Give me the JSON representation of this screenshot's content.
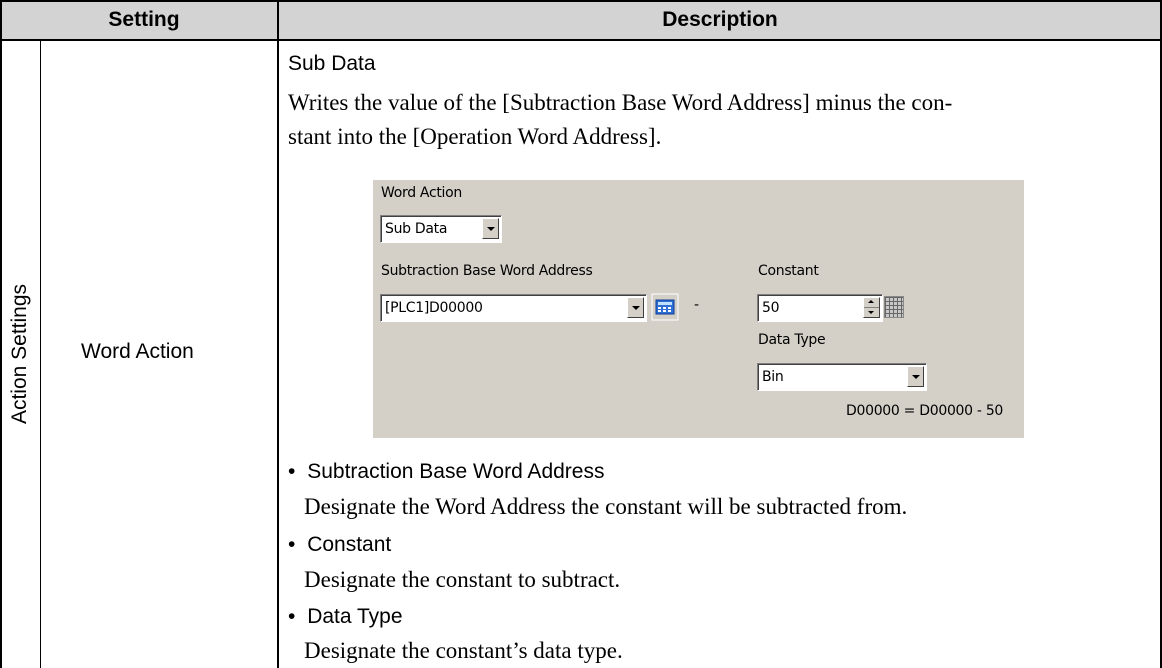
{
  "table": {
    "headers": {
      "setting": "Setting",
      "description": "Description"
    },
    "row_group": "Action Settings",
    "row_label": "Word Action"
  },
  "description": {
    "heading": "Sub Data",
    "paragraph_lines": [
      "Writes the value of the [Subtraction Base Word Address] minus the con-",
      "stant into the [Operation Word Address]."
    ],
    "bullets": [
      {
        "title": "Subtraction Base Word Address",
        "text": "Designate the Word Address the constant will be subtracted from."
      },
      {
        "title": "Constant",
        "text": "Designate the constant to subtract."
      },
      {
        "title": "Data Type",
        "text": "Designate the constant’s data type."
      }
    ],
    "bullet_char": "•"
  },
  "dialog": {
    "word_action_label": "Word Action",
    "word_action_value": "Sub Data",
    "base_address_label": "Subtraction Base Word Address",
    "base_address_value": "[PLC1]D00000",
    "minus_sign": "-",
    "constant_label": "Constant",
    "constant_value": "50",
    "data_type_label": "Data Type",
    "data_type_value": "Bin",
    "formula": "D00000 = D00000 - 50"
  },
  "colors": {
    "header_bg": "#d3d3d3",
    "dialog_bg": "#d4d0c8",
    "calc_icon": "#2f6fd6"
  },
  "icons": [
    "dropdown-arrow-icon",
    "calculator-icon",
    "spin-arrows-icon",
    "keypad-icon"
  ]
}
